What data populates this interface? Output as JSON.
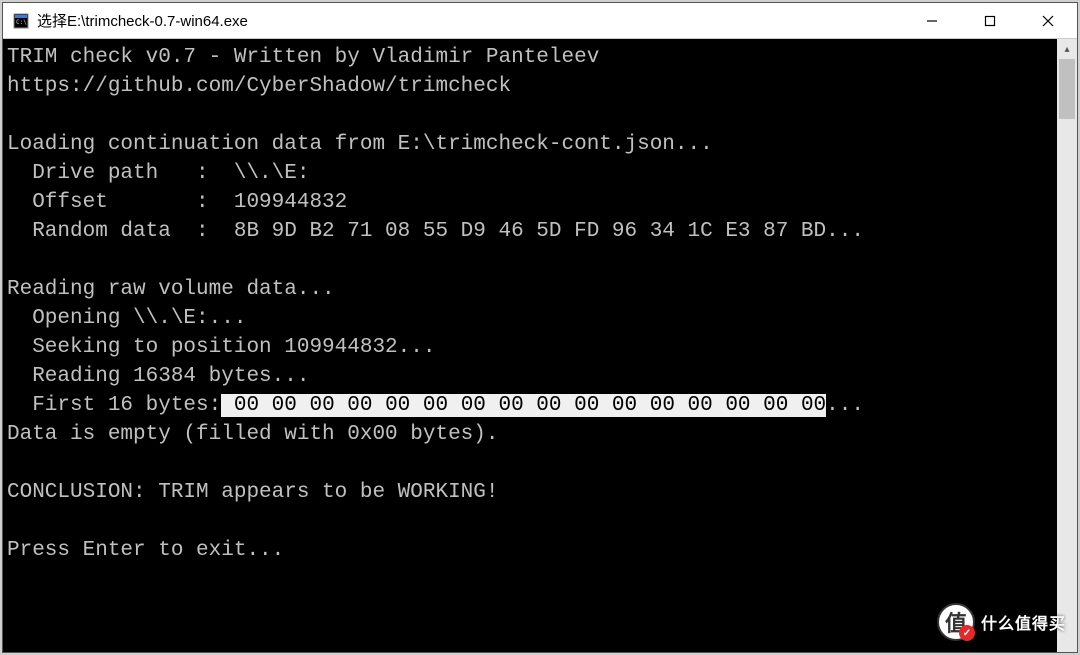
{
  "window": {
    "title": "选择E:\\trimcheck-0.7-win64.exe"
  },
  "console": {
    "line1": "TRIM check v0.7 - Written by Vladimir Panteleev",
    "line2": "https://github.com/CyberShadow/trimcheck",
    "line3": "",
    "line4": "Loading continuation data from E:\\trimcheck-cont.json...",
    "line5": "  Drive path   :  \\\\.\\E:",
    "line6": "  Offset       :  109944832",
    "line7": "  Random data  :  8B 9D B2 71 08 55 D9 46 5D FD 96 34 1C E3 87 BD...",
    "line8": "",
    "line9": "Reading raw volume data...",
    "line10": "  Opening \\\\.\\E:...",
    "line11": "  Seeking to position 109944832...",
    "line12": "  Reading 16384 bytes...",
    "line13_prefix": "  First 16 bytes:",
    "line13_highlight": " 00 00 00 00 00 00 00 00 00 00 00 00 00 00 00 00",
    "line13_suffix": "...",
    "line14": "Data is empty (filled with 0x00 bytes).",
    "line15": "",
    "line16": "CONCLUSION: TRIM appears to be WORKING!",
    "line17": "",
    "line18": "Press Enter to exit..."
  },
  "watermark": {
    "symbol": "值",
    "text": "什么值得买"
  }
}
